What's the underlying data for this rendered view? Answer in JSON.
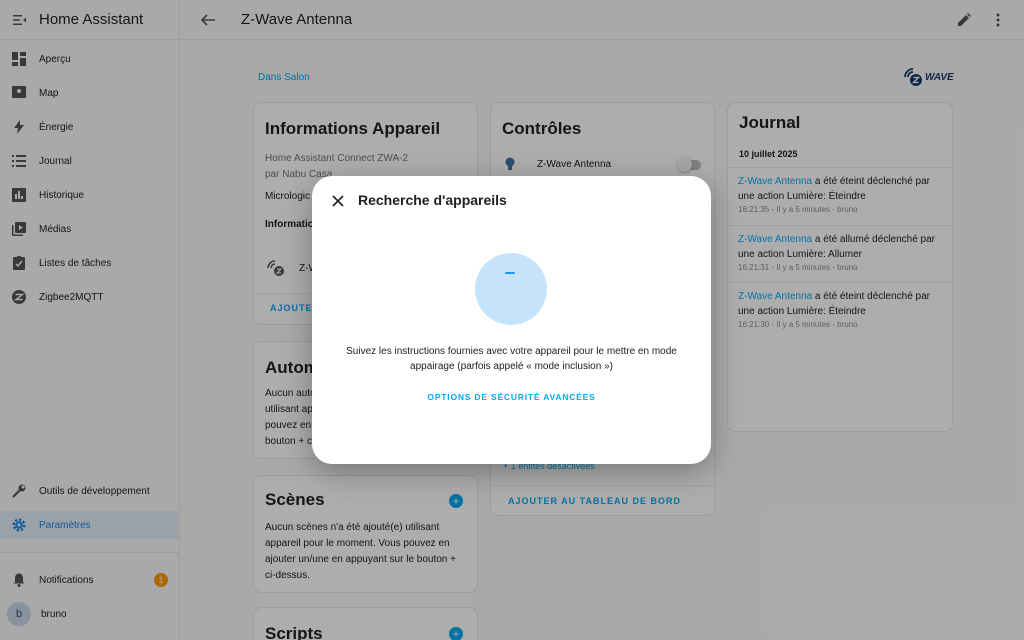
{
  "sidebar": {
    "title": "Home Assistant",
    "items": [
      {
        "label": "Aperçu"
      },
      {
        "label": "Map"
      },
      {
        "label": "Énergie"
      },
      {
        "label": "Journal"
      },
      {
        "label": "Historique"
      },
      {
        "label": "Médias"
      },
      {
        "label": "Listes de tâches"
      },
      {
        "label": "Zigbee2MQTT"
      }
    ],
    "dev_tools": "Outils de développement",
    "settings": "Paramètres",
    "notifications": "Notifications",
    "notification_count": "1",
    "user_initial": "b",
    "user_name": "bruno",
    "accent_color": "#1e88e5"
  },
  "header": {
    "title": "Z-Wave Antenna"
  },
  "breadcrumb": "Dans Salon",
  "zwave_logo_text": "WAVE",
  "device_info": {
    "title": "Informations Appareil",
    "model": "Home Assistant Connect ZWA-2",
    "manufacturer": "par Nabu Casa",
    "firmware_prefix": "Micrologic",
    "section_prefix": "Information",
    "entity_prefix": "Z-W",
    "action_prefix": "AJOUTER"
  },
  "automations": {
    "title_prefix": "Autom",
    "lines": [
      "Aucun auto",
      "utilisant ap",
      "pouvez en",
      "bouton + ci"
    ]
  },
  "scenes": {
    "title": "Scènes",
    "lines": [
      "Aucun scènes n'a été ajouté(e) utilisant",
      "appareil pour le moment. Vous pouvez en",
      "ajouter un/une en appuyant sur le bouton +",
      "ci-dessus."
    ]
  },
  "scripts": {
    "title": "Scripts"
  },
  "controls": {
    "title": "Contrôles",
    "entity_name": "Z-Wave Antenna",
    "disabled_entities": "+ 1 entités désactivées",
    "add_to_dashboard": "AJOUTER AU TABLEAU DE BORD"
  },
  "logbook": {
    "title": "Journal",
    "date": "10 juillet 2025",
    "entries": [
      {
        "entity": "Z-Wave Antenna",
        "text": " a été éteint déclenché par une action Lumière: Éteindre",
        "meta": "16:21:35 - Il y a 5 minutes - bruno"
      },
      {
        "entity": "Z-Wave Antenna",
        "text": " a été allumé déclenché par une action Lumière: Allumer",
        "meta": "16:21:31 - Il y a 5 minutes - bruno"
      },
      {
        "entity": "Z-Wave Antenna",
        "text": " a été éteint déclenché par une action Lumière: Éteindre",
        "meta": "16:21:30 - Il y a 5 minutes - bruno"
      }
    ]
  },
  "dialog": {
    "title": "Recherche d'appareils",
    "message_line1": "Suivez les instructions fournies avec votre appareil pour le mettre en mode",
    "message_line2": "appairage (parfois appelé « mode inclusion »)",
    "advanced_link": "OPTIONS DE SÉCURITÉ AVANCÉES"
  }
}
